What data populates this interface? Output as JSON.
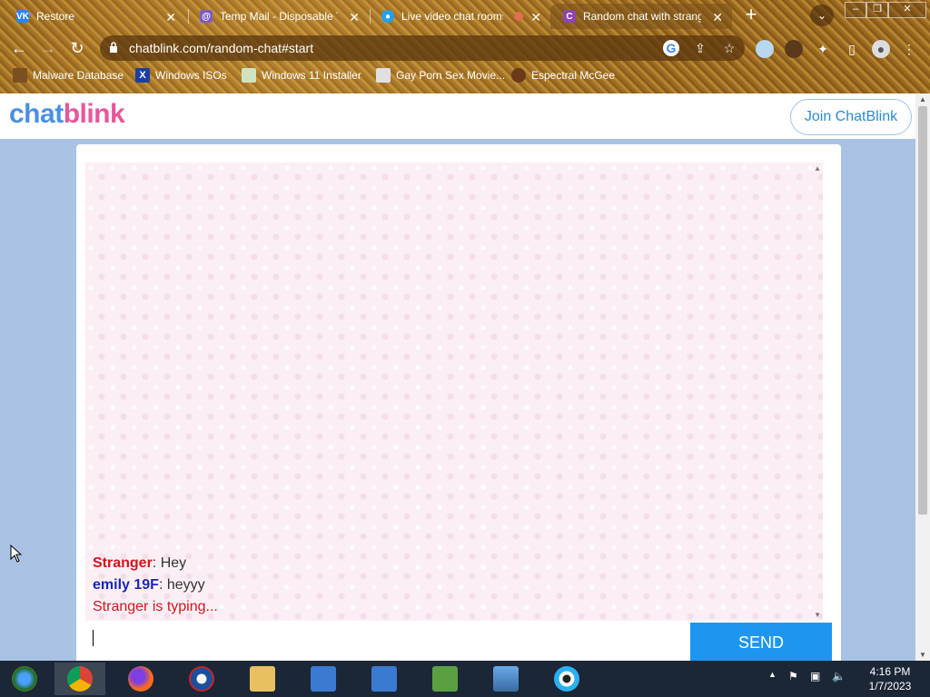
{
  "browser": {
    "tabs": [
      {
        "title": "Restore",
        "favicon": "VK",
        "color": "#2787f5"
      },
      {
        "title": "Temp Mail - Disposable Te",
        "favicon": "@",
        "color": "#7b5cc4"
      },
      {
        "title": "Live video chat rooms",
        "favicon": "●",
        "color": "#1da1f2"
      },
      {
        "title": "Random chat with strange",
        "favicon": "C",
        "color": "#8e44ad"
      }
    ],
    "url": "chatblink.com/random-chat#start",
    "bookmarks": [
      {
        "label": "Malware Database"
      },
      {
        "label": "Windows ISOs"
      },
      {
        "label": "Windows 11 Installer"
      },
      {
        "label": "Gay Porn Sex Movie..."
      },
      {
        "label": "Espectral McGee"
      }
    ]
  },
  "site": {
    "logo_part1": "chat",
    "logo_part2": "blink",
    "join_label": "Join ChatBlink"
  },
  "chat": {
    "messages": [
      {
        "sender": "Stranger",
        "text": ": Hey"
      },
      {
        "sender": "emily 19F",
        "text": ": heyyy"
      }
    ],
    "typing": "Stranger is typing...",
    "send_label": "SEND"
  },
  "taskbar": {
    "time": "4:16 PM",
    "date": "1/7/2023"
  }
}
